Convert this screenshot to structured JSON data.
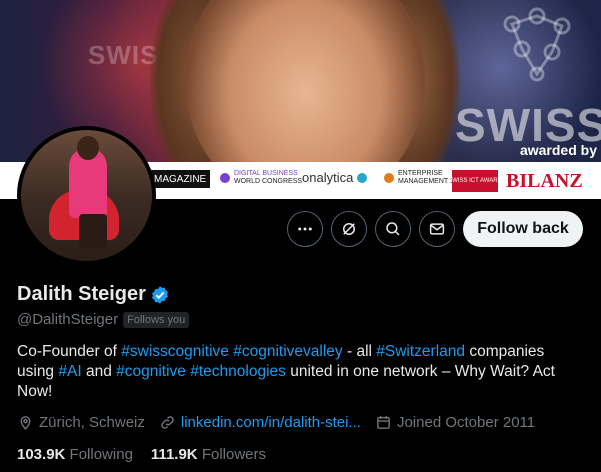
{
  "banner": {
    "brand_left": "SWISS",
    "brand_right": "SWISSCO",
    "awarded_by": "awarded by",
    "logos": {
      "magazine": "MAGAZINE",
      "dbwc_line1": "DIGITAL BUSINESS",
      "dbwc_line2": "WORLD CONGRESS",
      "onalytica": "onalytica",
      "emgmt_line1": "ENTERPRISE",
      "emgmt_line2": "MANAGEMENT 360°",
      "swissict": "SWISS ICT AWARD",
      "bilanz": "BILANZ"
    }
  },
  "actions": {
    "more_icon": "more-icon",
    "grok_icon": "grok-icon",
    "search_icon": "search-icon",
    "message_icon": "message-icon",
    "follow_back_label": "Follow back"
  },
  "profile": {
    "name": "Dalith Steiger",
    "handle": "@DalithSteiger",
    "follows_you": "Follows you",
    "bio": {
      "p1": "Co-Founder of ",
      "h1": "#swisscognitive",
      "s1": " ",
      "h2": "#cognitivevalley",
      "p2": " - all ",
      "h3": "#Switzerland",
      "p3": " companies using ",
      "h4": "#AI",
      "p4": " and ",
      "h5": "#cognitive",
      "s2": " ",
      "h6": "#technologies",
      "p5": " united in one network – Why Wait? Act Now!"
    },
    "location": "Zürich, Schweiz",
    "website": "linkedin.com/in/dalith-stei...",
    "joined": "Joined October 2011",
    "following_count": "103.9K",
    "following_label": "Following",
    "followers_count": "111.9K",
    "followers_label": "Followers"
  },
  "colors": {
    "accent": "#1d9bf0",
    "muted": "#71767b",
    "text": "#e7e9ea",
    "background": "#000000"
  }
}
